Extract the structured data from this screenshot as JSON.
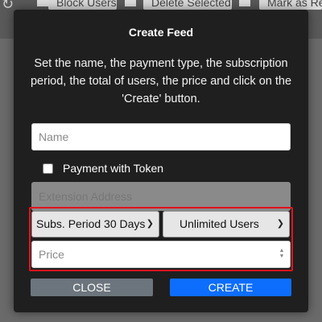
{
  "background": {
    "toolbar_buttons": [
      "Block Users",
      "Delete Selected",
      "Mark as Re"
    ]
  },
  "modal": {
    "title": "Create Feed",
    "description": "Set the name, the payment type, the subscription period, the total of users, the price and click on the 'Create' button.",
    "name_placeholder": "Name",
    "token_label": "Payment with Token",
    "token_checked": false,
    "extension_placeholder": "Extension Address",
    "period_select": "Subs. Period 30 Days",
    "users_select": "Unlimited Users",
    "price_placeholder": "Price",
    "close_label": "CLOSE",
    "create_label": "CREATE"
  },
  "colors": {
    "highlight": "#e0141e",
    "create_button": "#0d6efd",
    "close_button": "#6c757d"
  }
}
